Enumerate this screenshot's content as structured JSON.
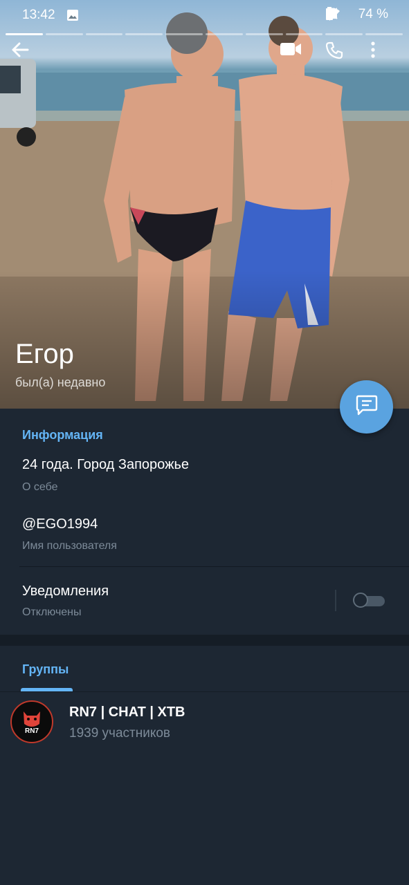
{
  "status_bar": {
    "time": "13:42",
    "battery": "74 %"
  },
  "toolbar": {
    "back_icon": "arrow-left-icon",
    "video_icon": "video-camera-icon",
    "call_icon": "phone-icon",
    "more_icon": "more-vertical-icon"
  },
  "story": {
    "segments": 10,
    "active_index": 0
  },
  "profile": {
    "name": "Егор",
    "status": "был(а) недавно"
  },
  "fab_icon": "message-icon",
  "info": {
    "title": "Информация",
    "bio": "24 года. Город Запорожье",
    "bio_label": "О себе",
    "username": "@EGO1994",
    "username_label": "Имя пользователя",
    "notifications": "Уведомления",
    "notifications_status": "Отключены",
    "notifications_enabled": false
  },
  "groups": {
    "tab_label": "Группы",
    "items": [
      {
        "title": "RN7 | CHAT | XTB",
        "subtitle": "1939 участников",
        "avatar_text": "RN7"
      }
    ]
  },
  "colors": {
    "accent": "#64b5f6",
    "fab": "#5aa3e0",
    "background": "#1d2733"
  }
}
